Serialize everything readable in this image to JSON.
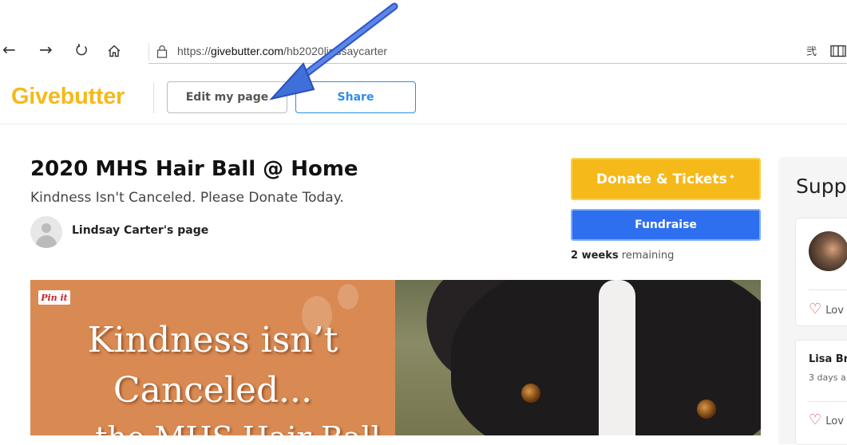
{
  "browser": {
    "url_prefix": "https://",
    "url_domain": "givebutter.com",
    "url_path": "/hb2020lindsaycarter",
    "icons": [
      "back-icon",
      "forward-icon",
      "refresh-icon",
      "home-icon",
      "lock-icon",
      "extensions-icon",
      "reading-view-icon"
    ]
  },
  "header": {
    "logo": "Givebutter",
    "edit_label": "Edit my page",
    "share_label": "Share"
  },
  "campaign": {
    "title": "2020 MHS Hair Ball @ Home",
    "subtitle": "Kindness Isn't Canceled. Please Donate Today.",
    "owner_label": "Lindsay Carter's page",
    "donate_label": "Donate & Tickets",
    "fundraise_label": "Fundraise",
    "remaining_bold": "2 weeks",
    "remaining_rest": " remaining"
  },
  "banner": {
    "pin_label": "Pin it",
    "line1": "Kindness isn’t",
    "line2": "Canceled...",
    "line3": "the MHS Hair Ball"
  },
  "sidebar": {
    "title": "Supp",
    "love_label": "Lov",
    "donor_name": "Lisa Br",
    "donor_time": "3 days a",
    "love_label2": "Lov"
  },
  "colors": {
    "brand_yellow": "#f6b91a",
    "share_blue": "#2d8cf0",
    "fundraise_blue": "#2e6ff0",
    "arrow_blue": "#3f6fd8",
    "heart_red": "#d9434a"
  }
}
